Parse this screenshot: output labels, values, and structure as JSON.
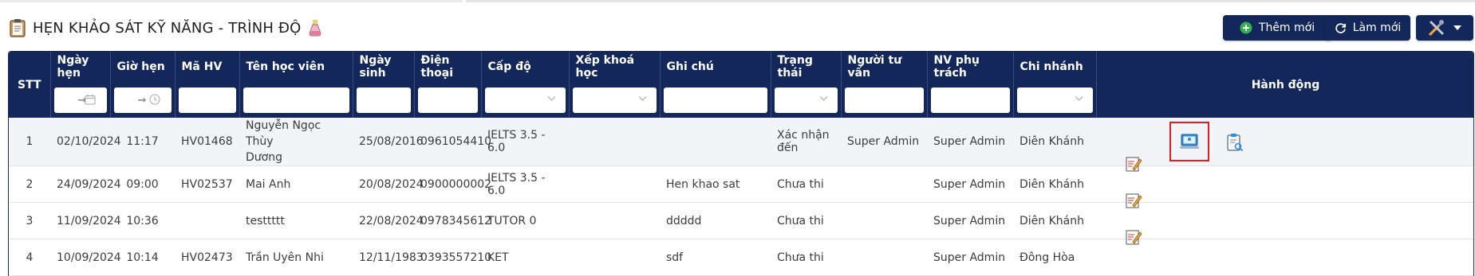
{
  "page": {
    "title": "HẸN KHẢO SÁT KỸ NĂNG - TRÌNH ĐỘ"
  },
  "toolbar": {
    "add_label": "Thêm mới",
    "reload_label": "Làm mới"
  },
  "table": {
    "columns": [
      "STT",
      "Ngày hẹn",
      "Giờ hẹn",
      "Mã HV",
      "Tên học viên",
      "Ngày sinh",
      "Điện thoại",
      "Cấp độ",
      "Xếp khoá học",
      "Ghi chú",
      "Trạng thái",
      "Người tư vấn",
      "NV phụ trách",
      "Chi nhánh",
      "Hành động"
    ],
    "date_range_arrow": "→",
    "rows": [
      {
        "stt": "1",
        "ngay_hen": "02/10/2024",
        "gio_hen": "11:17",
        "ma_hv": "HV01468",
        "ten_line1": "Nguyễn Ngọc Thùy",
        "ten_line2": "Dương",
        "ngay_sinh": "25/08/2016",
        "dien_thoai": "0961054410",
        "cap_do": "IELTS 3.5 - 6.0",
        "xep_khoa": "",
        "ghi_chu": "",
        "trang_thai": "Xác nhận đến",
        "nguoi_tu_van": "Super Admin",
        "nv_phu_trach": "Super Admin",
        "chi_nhanh": "Diên Khánh"
      },
      {
        "stt": "2",
        "ngay_hen": "24/09/2024",
        "gio_hen": "09:00",
        "ma_hv": "HV02537",
        "ten": "Mai Anh",
        "ngay_sinh": "20/08/2024",
        "dien_thoai": "0900000002",
        "cap_do": "IELTS 3.5 - 6.0",
        "xep_khoa": "",
        "ghi_chu": "Hen khao sat",
        "trang_thai": "Chưa thi",
        "nguoi_tu_van": "",
        "nv_phu_trach": "Super Admin",
        "chi_nhanh": "Diên Khánh"
      },
      {
        "stt": "3",
        "ngay_hen": "11/09/2024",
        "gio_hen": "10:36",
        "ma_hv": "",
        "ten": "testtttt",
        "ngay_sinh": "22/08/2024",
        "dien_thoai": "0978345612",
        "cap_do": "TUTOR 0",
        "xep_khoa": "",
        "ghi_chu": "ddddd",
        "trang_thai": "Chưa thi",
        "nguoi_tu_van": "",
        "nv_phu_trach": "Super Admin",
        "chi_nhanh": "Diên Khánh"
      },
      {
        "stt": "4",
        "ngay_hen": "10/09/2024",
        "gio_hen": "10:14",
        "ma_hv": "HV02473",
        "ten": "Trần Uyên Nhi",
        "ngay_sinh": "12/11/1983",
        "dien_thoai": "0393557210",
        "cap_do": "KET",
        "xep_khoa": "",
        "ghi_chu": "sdf",
        "trang_thai": "Chưa thi",
        "nguoi_tu_van": "",
        "nv_phu_trach": "Super Admin",
        "chi_nhanh": "Đông Hòa"
      }
    ]
  },
  "icons": {
    "clipboard": "clipboard-icon",
    "test_tube": "test-tube-icon",
    "add": "plus-circle-icon",
    "reload": "refresh-icon",
    "tools": "tools-icon",
    "calendar": "calendar-icon",
    "clock": "clock-icon",
    "exam": "online-exam-icon",
    "result": "search-document-icon",
    "edit": "edit-note-icon"
  },
  "colors": {
    "header_bg": "#13275a",
    "button_bg": "#13275a",
    "add_icon": "#2fb14b",
    "highlight_border": "#e02020",
    "selected_row_bg": "#f3f4f7"
  }
}
